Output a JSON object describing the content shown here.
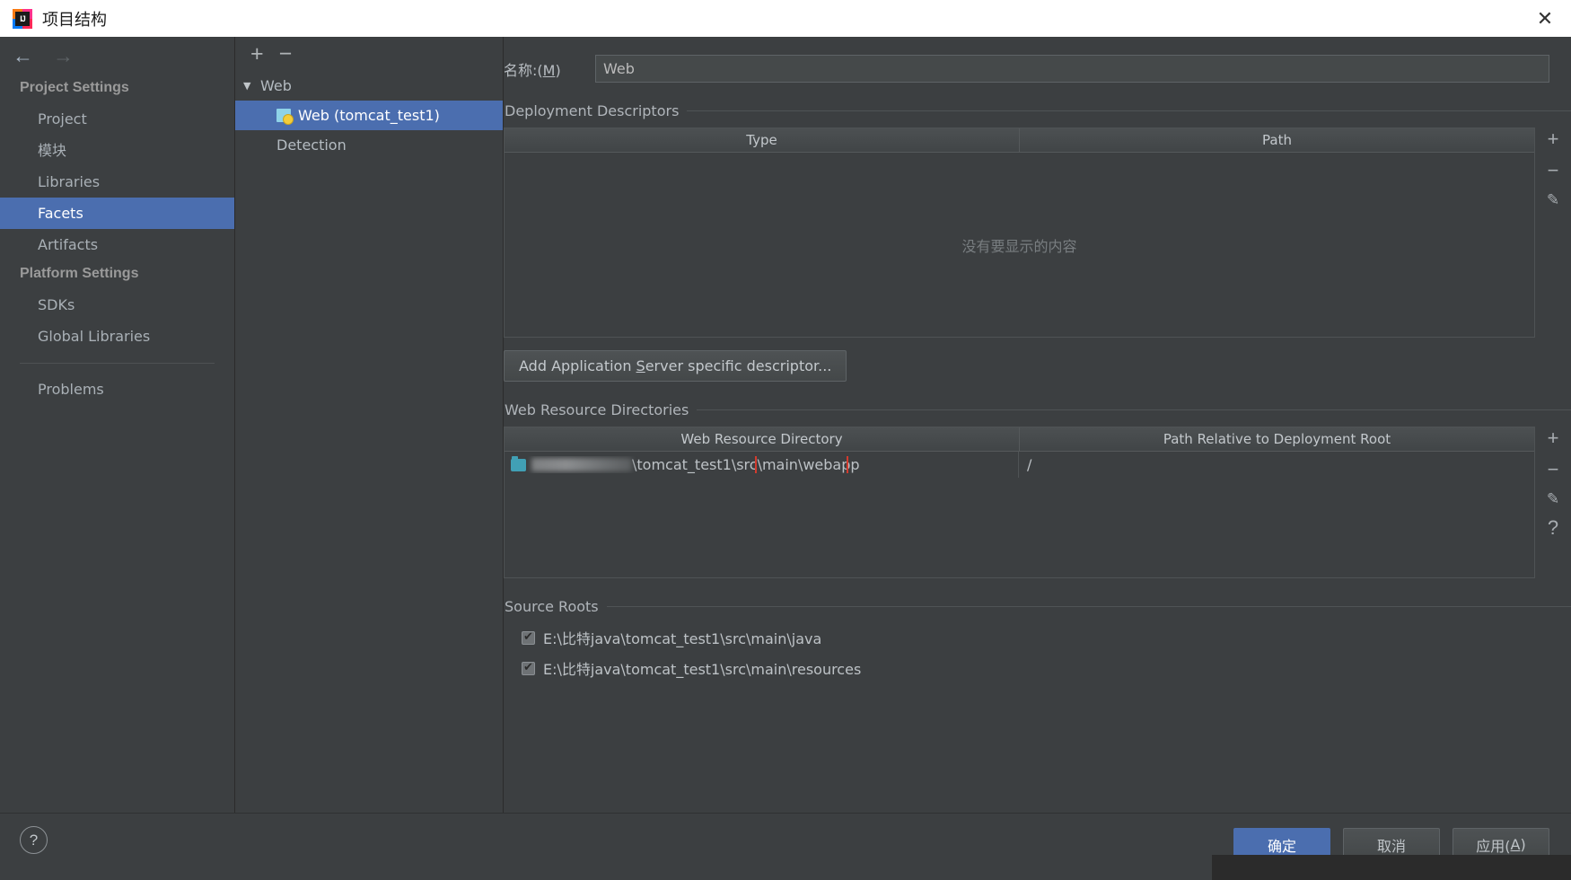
{
  "window": {
    "title": "项目结构",
    "logo_letters": "IJ",
    "close_icon": "✕"
  },
  "nav": {
    "back_icon": "←",
    "forward_icon": "→"
  },
  "sidebar": {
    "groups": [
      {
        "label": "Project Settings",
        "items": [
          {
            "label": "Project",
            "selected": false
          },
          {
            "label": "模块",
            "selected": false
          },
          {
            "label": "Libraries",
            "selected": false
          },
          {
            "label": "Facets",
            "selected": true
          },
          {
            "label": "Artifacts",
            "selected": false
          }
        ]
      },
      {
        "label": "Platform Settings",
        "items": [
          {
            "label": "SDKs",
            "selected": false
          },
          {
            "label": "Global Libraries",
            "selected": false
          }
        ]
      }
    ],
    "problems_label": "Problems"
  },
  "tree": {
    "toolbar": {
      "add_icon": "+",
      "remove_icon": "−"
    },
    "root_label": "Web",
    "root_twisty": "▼",
    "child_label": "Web (tomcat_test1)",
    "detection_label": "Detection"
  },
  "facet": {
    "name_label_prefix": "名称:(",
    "name_label_mnemonic": "M",
    "name_label_suffix": ")",
    "name_value": "Web",
    "deployment": {
      "section_title": "Deployment Descriptors",
      "columns": [
        "Type",
        "Path"
      ],
      "empty_message": "没有要显示的内容",
      "tools": [
        "+",
        "−",
        "✎"
      ],
      "add_descriptor_button_pre": "Add Application ",
      "add_descriptor_button_mnemonic": "S",
      "add_descriptor_button_post": "erver specific descriptor..."
    },
    "web_resources": {
      "section_title": "Web Resource Directories",
      "columns": [
        "Web Resource Directory",
        "Path Relative to Deployment Root"
      ],
      "rows": [
        {
          "directory_redacted": "E:\\比特java\\",
          "directory_visible": "\\tomcat_test1\\src\\main\\webapp",
          "relative_path": "/"
        }
      ],
      "tools": [
        "+",
        "−",
        "✎",
        "?"
      ],
      "annotation": "red-highlight-box"
    },
    "source_roots": {
      "section_title": "Source Roots",
      "items": [
        {
          "label": "E:\\比特java\\tomcat_test1\\src\\main\\java",
          "checked": true
        },
        {
          "label": "E:\\比特java\\tomcat_test1\\src\\main\\resources",
          "checked": true
        }
      ]
    }
  },
  "footer": {
    "help_icon": "?",
    "ok_label": "确定",
    "cancel_label": "取消",
    "apply_label_pre": "应用(",
    "apply_label_mnemonic": "A",
    "apply_label_suffix": ")"
  },
  "colors": {
    "accent": "#4b6eaf",
    "annotation": "#d23b2e",
    "background": "#3c3f41",
    "titlebar": "#ffffff"
  }
}
